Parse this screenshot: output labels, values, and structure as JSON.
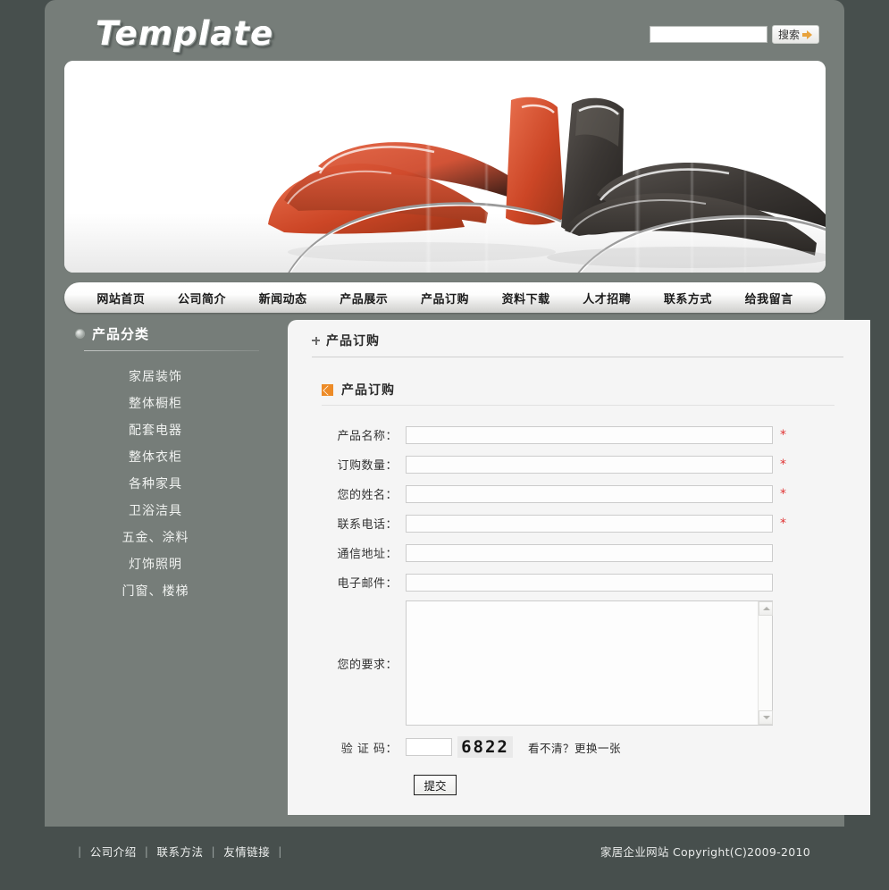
{
  "header": {
    "logo": "Template",
    "search": {
      "value": "",
      "placeholder": "",
      "button_label": "搜索",
      "icon": "arrow-right-icon"
    }
  },
  "nav": {
    "items": [
      {
        "label": "网站首页"
      },
      {
        "label": "公司简介"
      },
      {
        "label": "新闻动态"
      },
      {
        "label": "产品展示"
      },
      {
        "label": "产品订购"
      },
      {
        "label": "资料下载"
      },
      {
        "label": "人才招聘"
      },
      {
        "label": "联系方式"
      },
      {
        "label": "给我留言"
      }
    ]
  },
  "banner": {
    "alt": "red-and-black-lounge-chairs"
  },
  "sidebar": {
    "title": "产品分类",
    "bullet_icon": "sphere-bullet-icon",
    "items": [
      {
        "label": "家居装饰"
      },
      {
        "label": "整体橱柜"
      },
      {
        "label": "配套电器"
      },
      {
        "label": "整体衣柜"
      },
      {
        "label": "各种家具"
      },
      {
        "label": "卫浴洁具"
      },
      {
        "label": "五金、涂料"
      },
      {
        "label": "灯饰照明"
      },
      {
        "label": "门窗、楼梯"
      }
    ]
  },
  "content": {
    "breadcrumb": "产品订购",
    "breadcrumb_icon": "plus-marker-icon",
    "section_title": "产品订购",
    "section_icon": "orange-arrow-icon",
    "form": {
      "fields": [
        {
          "label": "产品名称：",
          "value": "",
          "required": true
        },
        {
          "label": "订购数量：",
          "value": "",
          "required": true
        },
        {
          "label": "您的姓名：",
          "value": "",
          "required": true
        },
        {
          "label": "联系电话：",
          "value": "",
          "required": true
        },
        {
          "label": "通信地址：",
          "value": "",
          "required": false
        },
        {
          "label": "电子邮件：",
          "value": "",
          "required": false
        }
      ],
      "textarea": {
        "label": "您的要求：",
        "value": ""
      },
      "captcha": {
        "label": "验 证 码：",
        "value": "",
        "code": "6822",
        "refresh_text": "看不清？更换一张"
      },
      "submit_label": "提交"
    }
  },
  "footer": {
    "links": [
      {
        "label": "公司介绍"
      },
      {
        "label": "联系方法"
      },
      {
        "label": "友情链接"
      }
    ],
    "copyright": "家居企业网站  Copyright(C)2009-2010"
  },
  "colors": {
    "page_bg": "#474f4d",
    "shell_bg": "#767d79",
    "content_bg": "#f5f5f5",
    "accent_orange": "#ed8b27",
    "required_red": "#e03434"
  }
}
